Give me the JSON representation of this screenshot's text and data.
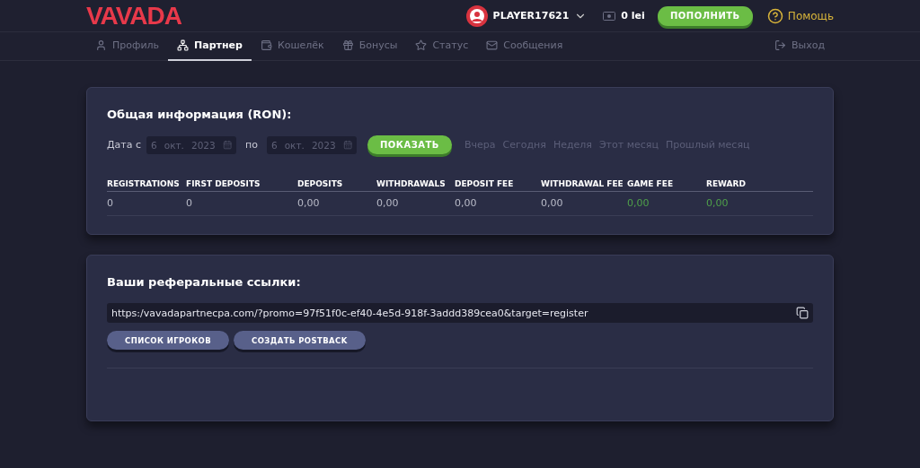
{
  "header": {
    "logo": "VAVADA",
    "user": {
      "name": "PLAYER17621"
    },
    "balance": "0 lei",
    "deposit_button": "ПОПОЛНИТЬ",
    "help": "Помощь"
  },
  "nav": {
    "items": [
      {
        "label": "Профиль",
        "selected": false
      },
      {
        "label": "Партнер",
        "selected": true
      },
      {
        "label": "Кошелёк",
        "selected": false
      },
      {
        "label": "Бонусы",
        "selected": false
      },
      {
        "label": "Статус",
        "selected": false
      },
      {
        "label": "Сообщения",
        "selected": false
      }
    ],
    "logout": "Выход"
  },
  "summary": {
    "title": "Общая информация (RON):",
    "date_from_label": "Дата с",
    "date_from": {
      "day": "6",
      "month": "окт.",
      "year": "2023"
    },
    "date_to_label": "по",
    "date_to": {
      "day": "6",
      "month": "окт.",
      "year": "2023"
    },
    "show_button": "ПОКАЗАТЬ",
    "periods": [
      {
        "label": "Вчера",
        "selected": false
      },
      {
        "label": "Сегодня",
        "selected": false
      },
      {
        "label": "Неделя",
        "selected": false
      },
      {
        "label": "Этот месяц",
        "selected": false
      },
      {
        "label": "Прошлый месяц",
        "selected": false
      }
    ],
    "table": {
      "columns": [
        "REGISTRATIONS",
        "FIRST DEPOSITS",
        "DEPOSITS",
        "WITHDRAWALS",
        "DEPOSIT FEE",
        "WITHDRAWAL FEE",
        "GAME FEE",
        "REWARD"
      ],
      "rows": [
        [
          {
            "text": "0"
          },
          {
            "text": "0"
          },
          {
            "text": "0,00"
          },
          {
            "text": "0,00"
          },
          {
            "text": "0,00"
          },
          {
            "text": "0,00"
          },
          {
            "text": "0,00",
            "color": "#4fa04a"
          },
          {
            "text": "0,00",
            "color": "#4fa04a"
          }
        ]
      ]
    }
  },
  "referral": {
    "title": "Ваши реферальные ссылки:",
    "link": "https:/vavadapartnecpa.com/?promo=97f51f0c-ef40-4e5d-918f-3addd389cea0&target=register",
    "buttons": [
      "СПИСОК ИГРОКОВ",
      "СОЗДАТЬ POSTBACK"
    ]
  }
}
